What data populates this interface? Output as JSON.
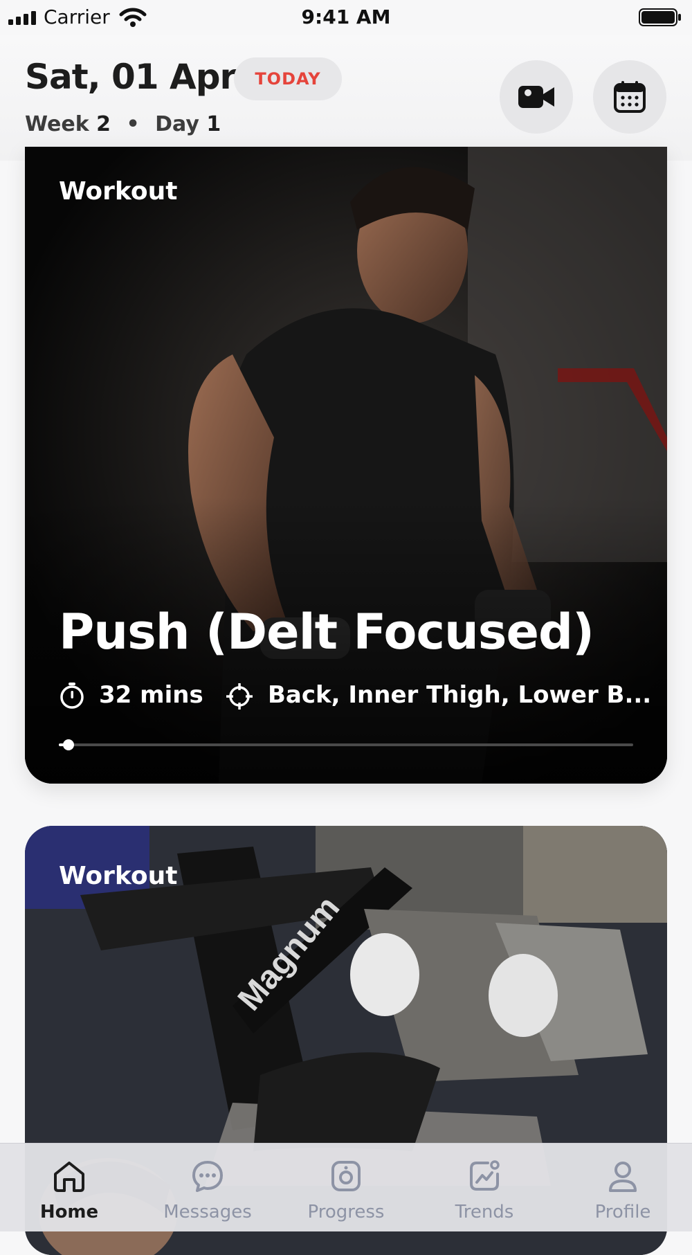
{
  "status_bar": {
    "carrier": "Carrier",
    "time": "9:41 AM"
  },
  "header": {
    "date": "Sat, 01 Apr",
    "today_badge": "TODAY",
    "week_label": "Week",
    "week_number": "2",
    "separator": "•",
    "day_label": "Day",
    "day_number": "1",
    "icons": [
      "video-camera-icon",
      "calendar-icon"
    ]
  },
  "cards": [
    {
      "label": "Workout",
      "title": "Push (Delt Focused)",
      "duration": "32 mins",
      "muscles": "Back, Inner Thigh, Lower B...",
      "progress": 0.01
    },
    {
      "label": "Workout"
    }
  ],
  "tabbar": {
    "tabs": [
      {
        "label": "Home",
        "icon": "home-icon",
        "active": true
      },
      {
        "label": "Messages",
        "icon": "chat-icon",
        "active": false
      },
      {
        "label": "Progress",
        "icon": "camera-icon",
        "active": false
      },
      {
        "label": "Trends",
        "icon": "trends-icon",
        "active": false
      },
      {
        "label": "Profile",
        "icon": "profile-icon",
        "active": false
      }
    ]
  },
  "colors": {
    "accent": "#e5443b",
    "tab_inactive": "#8d93a5",
    "tab_active": "#1c1c1c"
  }
}
